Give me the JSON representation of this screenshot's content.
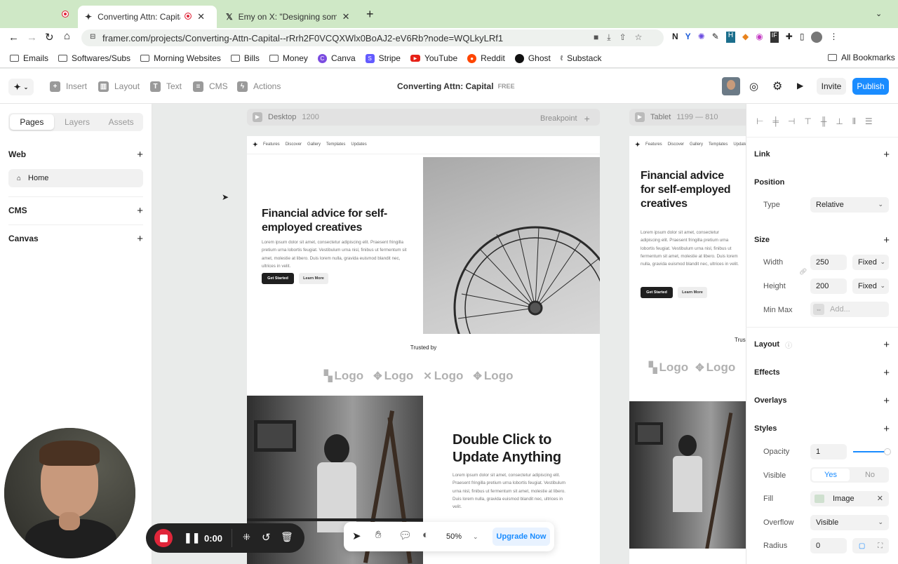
{
  "browser": {
    "tabs": [
      {
        "title": "Converting Attn: Capital –",
        "active": true
      },
      {
        "title": "Emy on X: \"Designing someth",
        "active": false
      }
    ],
    "url": "framer.com/projects/Converting-Attn-Capital--rRrh2F0VCQXWlx0BoAJ2-eV6Rb?node=WQLkyLRf1",
    "bookmarks": [
      "Emails",
      "Softwares/Subs",
      "Morning Websites",
      "Bills",
      "Money",
      "Canva",
      "Stripe",
      "YouTube",
      "Reddit",
      "Ghost",
      "Substack"
    ],
    "all_bookmarks": "All Bookmarks"
  },
  "toolbar": {
    "insert": "Insert",
    "layout": "Layout",
    "text": "Text",
    "cms": "CMS",
    "actions": "Actions",
    "project_title": "Converting Attn: Capital",
    "plan_badge": "FREE",
    "invite": "Invite",
    "publish": "Publish"
  },
  "left_panel": {
    "tabs": [
      "Pages",
      "Layers",
      "Assets"
    ],
    "web_label": "Web",
    "home_page": "Home",
    "cms_label": "CMS",
    "canvas_label": "Canvas"
  },
  "canvas": {
    "desktop_label": "Desktop",
    "desktop_width": "1200",
    "breakpoint": "Breakpoint",
    "tablet_label": "Tablet",
    "tablet_range": "1199 — 810",
    "nav": [
      "Features",
      "Discover",
      "Gallery",
      "Templates",
      "Updates"
    ],
    "hero_title": "Financial advice for self-employed creatives",
    "hero_text": "Lorem ipsum dolor sit amet, consectetur adipiscing elit. Praesent fringilla pretium urna lobortis feugiat. Vestibulum urna nisl, finibus ut fermentum sit amet, molestie at libero. Duis lorem nulla, gravida euismod blandit nec, ultrices in velit.",
    "get_started": "Get Started",
    "learn_more": "Learn More",
    "trusted_by": "Trusted by",
    "tablet_trusted_fragment": "Trus",
    "logo_text": "Logo",
    "section2_title": "Double Click to Update Anything",
    "section2_text": "Lorem ipsum dolor sit amet, consectetur adipiscing elit. Praesent fringilla pretium urna lobortis feugiat. Vestibulum urna nisl, finibus ut fermentum sit amet, molestie at libero. Duis lorem nulla, gravida euismod blandit nec, ultrices in velit."
  },
  "right_panel": {
    "link": "Link",
    "position": "Position",
    "type_label": "Type",
    "type_value": "Relative",
    "size": "Size",
    "width_label": "Width",
    "width_value": "250",
    "width_mode": "Fixed",
    "height_label": "Height",
    "height_value": "200",
    "height_mode": "Fixed",
    "minmax_label": "Min Max",
    "minmax_placeholder": "Add...",
    "layout": "Layout",
    "effects": "Effects",
    "overlays": "Overlays",
    "styles": "Styles",
    "opacity_label": "Opacity",
    "opacity_value": "1",
    "visible_label": "Visible",
    "visible_yes": "Yes",
    "visible_no": "No",
    "fill_label": "Fill",
    "fill_value": "Image",
    "overflow_label": "Overflow",
    "overflow_value": "Visible",
    "radius_label": "Radius",
    "radius_value": "0"
  },
  "recorder": {
    "time": "0:00"
  },
  "bottom_toolbar": {
    "zoom": "50%",
    "upgrade": "Upgrade Now"
  },
  "colors": {
    "accent": "#1a8cff",
    "record": "#e0263a"
  }
}
